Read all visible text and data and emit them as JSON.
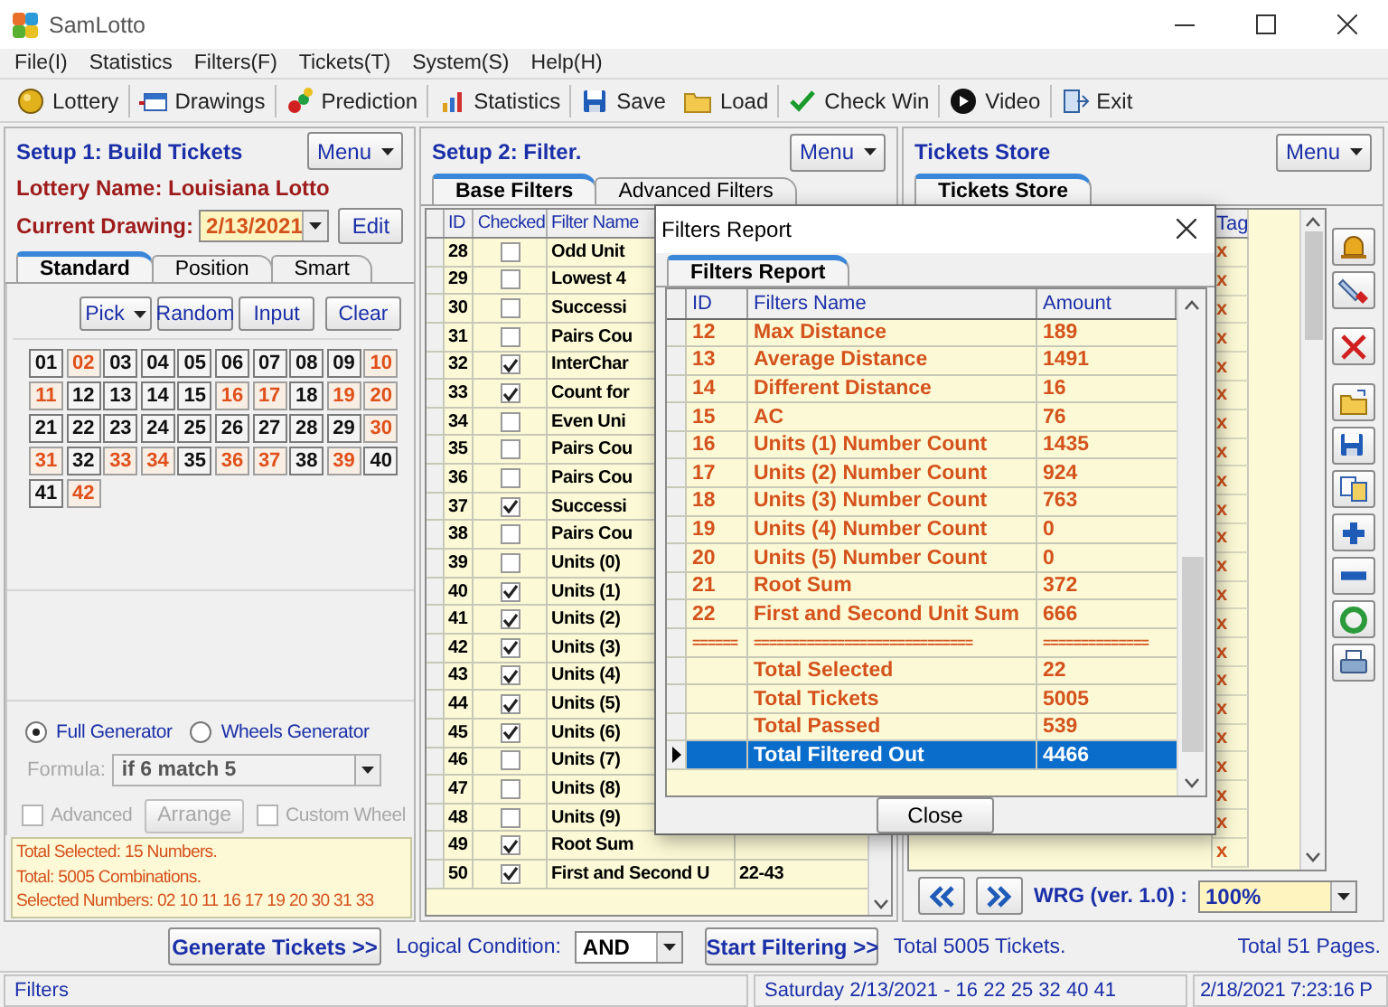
{
  "window": {
    "title": "SamLotto"
  },
  "menu": [
    "File(I)",
    "Statistics",
    "Filters(F)",
    "Tickets(T)",
    "System(S)",
    "Help(H)"
  ],
  "toolbar": [
    {
      "label": "Lottery",
      "kind": "lottery"
    },
    {
      "label": "Drawings",
      "kind": "drawings"
    },
    {
      "label": "Prediction",
      "kind": "prediction"
    },
    {
      "label": "Statistics",
      "kind": "statistics"
    },
    {
      "label": "Save",
      "kind": "save"
    },
    {
      "label": "Load",
      "kind": "load"
    },
    {
      "label": "Check Win",
      "kind": "checkwin"
    },
    {
      "label": "Video",
      "kind": "video"
    },
    {
      "label": "Exit",
      "kind": "exit"
    }
  ],
  "build": {
    "title": "Setup 1: Build  Tickets",
    "menu": "Menu",
    "lottery": "Lottery  Name: Louisiana Lotto",
    "drawing_label": "Current Drawing:",
    "drawing_value": "2/13/2021",
    "edit": "Edit",
    "tabs": [
      {
        "label": "Standard",
        "selected": true
      },
      {
        "label": "Position",
        "selected": false
      },
      {
        "label": "Smart",
        "selected": false
      }
    ],
    "pick": "Pick",
    "buttons": [
      "Random",
      "Input",
      "Clear"
    ],
    "numbers": [
      {
        "label": "01",
        "selected": false
      },
      {
        "label": "02",
        "selected": true
      },
      {
        "label": "03",
        "selected": false
      },
      {
        "label": "04",
        "selected": false
      },
      {
        "label": "05",
        "selected": false
      },
      {
        "label": "06",
        "selected": false
      },
      {
        "label": "07",
        "selected": false
      },
      {
        "label": "08",
        "selected": false
      },
      {
        "label": "09",
        "selected": false
      },
      {
        "label": "10",
        "selected": true
      },
      {
        "label": "11",
        "selected": true
      },
      {
        "label": "12",
        "selected": false
      },
      {
        "label": "13",
        "selected": false
      },
      {
        "label": "14",
        "selected": false
      },
      {
        "label": "15",
        "selected": false
      },
      {
        "label": "16",
        "selected": true
      },
      {
        "label": "17",
        "selected": true
      },
      {
        "label": "18",
        "selected": false
      },
      {
        "label": "19",
        "selected": true
      },
      {
        "label": "20",
        "selected": true
      },
      {
        "label": "21",
        "selected": false
      },
      {
        "label": "22",
        "selected": false
      },
      {
        "label": "23",
        "selected": false
      },
      {
        "label": "24",
        "selected": false
      },
      {
        "label": "25",
        "selected": false
      },
      {
        "label": "26",
        "selected": false
      },
      {
        "label": "27",
        "selected": false
      },
      {
        "label": "28",
        "selected": false
      },
      {
        "label": "29",
        "selected": false
      },
      {
        "label": "30",
        "selected": true
      },
      {
        "label": "31",
        "selected": true
      },
      {
        "label": "32",
        "selected": false
      },
      {
        "label": "33",
        "selected": true
      },
      {
        "label": "34",
        "selected": true
      },
      {
        "label": "35",
        "selected": false
      },
      {
        "label": "36",
        "selected": true
      },
      {
        "label": "37",
        "selected": true
      },
      {
        "label": "38",
        "selected": false
      },
      {
        "label": "39",
        "selected": true
      },
      {
        "label": "40",
        "selected": false
      },
      {
        "label": "41",
        "selected": false
      },
      {
        "label": "42",
        "selected": true
      }
    ],
    "generator": [
      {
        "label": "Full Generator",
        "selected": true
      },
      {
        "label": "Wheels Generator",
        "selected": false
      }
    ],
    "formula": {
      "label": "Formula:",
      "value": "if 6 match 5",
      "disabled": true
    },
    "options": [
      {
        "kind": "checkbox",
        "label": "Advanced",
        "checked": false,
        "disabled": true
      },
      {
        "kind": "button",
        "label": "Arrange",
        "disabled": true
      },
      {
        "kind": "checkbox",
        "label": "Custom Wheel",
        "checked": false,
        "disabled": true
      }
    ],
    "info": [
      "Total Selected: 15 Numbers.",
      "Total: 5005 Combinations.",
      "Selected Numbers: 02 10 11 16 17 19 20 30 31 33"
    ]
  },
  "filter": {
    "title": "Setup 2: Filter.",
    "menu": "Menu",
    "tabs": [
      {
        "label": "Base Filters",
        "selected": true
      },
      {
        "label": "Advanced Filters",
        "selected": false
      }
    ],
    "columns": [
      "ID",
      "Checked",
      "Filter Name"
    ],
    "rows": [
      {
        "id": "28",
        "checked": false,
        "name": "Odd Unit"
      },
      {
        "id": "29",
        "checked": false,
        "name": "Lowest 4"
      },
      {
        "id": "30",
        "checked": false,
        "name": "Successi"
      },
      {
        "id": "31",
        "checked": false,
        "name": "Pairs Cou"
      },
      {
        "id": "32",
        "checked": true,
        "name": "InterChar"
      },
      {
        "id": "33",
        "checked": true,
        "name": "Count for"
      },
      {
        "id": "34",
        "checked": false,
        "name": "Even Uni"
      },
      {
        "id": "35",
        "checked": false,
        "name": "Pairs Cou"
      },
      {
        "id": "36",
        "checked": false,
        "name": "Pairs Cou"
      },
      {
        "id": "37",
        "checked": true,
        "name": "Successi"
      },
      {
        "id": "38",
        "checked": false,
        "name": "Pairs Cou"
      },
      {
        "id": "39",
        "checked": false,
        "name": "Units (0)"
      },
      {
        "id": "40",
        "checked": true,
        "name": "Units (1)"
      },
      {
        "id": "41",
        "checked": true,
        "name": "Units (2)"
      },
      {
        "id": "42",
        "checked": true,
        "name": "Units (3)"
      },
      {
        "id": "43",
        "checked": true,
        "name": "Units (4)"
      },
      {
        "id": "44",
        "checked": true,
        "name": "Units (5)"
      },
      {
        "id": "45",
        "checked": true,
        "name": "Units (6)"
      },
      {
        "id": "46",
        "checked": false,
        "name": "Units (7)"
      },
      {
        "id": "47",
        "checked": false,
        "name": "Units (8)"
      },
      {
        "id": "48",
        "checked": false,
        "name": "Units (9)"
      },
      {
        "id": "49",
        "checked": true,
        "name": "Root Sum"
      },
      {
        "id": "50",
        "checked": true,
        "name": "First and Second U",
        "column_4": "22-43"
      }
    ]
  },
  "store": {
    "title": "Tickets Store",
    "menu": "Menu",
    "tabs": [
      {
        "label": "Tickets Store",
        "selected": true
      }
    ],
    "columns": [
      "Tag"
    ],
    "rows": [
      {
        "tag": "x"
      },
      {
        "tag": "x"
      },
      {
        "tag": "x"
      },
      {
        "tag": "x"
      },
      {
        "tag": "x"
      },
      {
        "tag": "x"
      },
      {
        "tag": "x"
      },
      {
        "tag": "x"
      },
      {
        "tag": "x"
      },
      {
        "tag": "x"
      },
      {
        "tag": "x"
      },
      {
        "tag": "x"
      },
      {
        "tag": "x"
      },
      {
        "tag": "x"
      },
      {
        "tag": "x"
      },
      {
        "tag": "x"
      },
      {
        "tag": "x"
      },
      {
        "tag": "x"
      },
      {
        "tag": "x"
      },
      {
        "tag": "x"
      },
      {
        "tag": "x"
      },
      {
        "tag": "x"
      }
    ],
    "tools": [
      {
        "kind": "bell"
      },
      {
        "kind": "marker"
      },
      {
        "kind": "delete"
      },
      {
        "kind": "open"
      },
      {
        "kind": "save"
      },
      {
        "kind": "copy"
      },
      {
        "kind": "add"
      },
      {
        "kind": "remove"
      },
      {
        "kind": "recycle"
      },
      {
        "kind": "print"
      }
    ],
    "version": "WRG (ver. 1.0) :",
    "zoom": "100%"
  },
  "actions": {
    "generate": "Generate Tickets >>",
    "logic_label": "Logical Condition:",
    "logic_value": "AND",
    "start": "Start Filtering >>",
    "total_tickets": "Total 5005 Tickets.",
    "total_pages": "Total 51 Pages."
  },
  "status_bar": [
    "Filters",
    "Saturday 2/13/2021 - 16 22 25 32 40 41",
    "2/18/2021 7:23:16 P"
  ],
  "dialog": {
    "title": "Filters Report",
    "tab": "Filters Report",
    "columns": [
      "ID",
      "Filters Name",
      "Amount"
    ],
    "rows": [
      {
        "id": "12",
        "name": "Max Distance",
        "amount": "189",
        "selected": false
      },
      {
        "id": "13",
        "name": "Average Distance",
        "amount": "1491",
        "selected": false
      },
      {
        "id": "14",
        "name": "Different Distance",
        "amount": "16",
        "selected": false
      },
      {
        "id": "15",
        "name": "AC",
        "amount": "76",
        "selected": false
      },
      {
        "id": "16",
        "name": "Units (1) Number Count",
        "amount": "1435",
        "selected": false
      },
      {
        "id": "17",
        "name": "Units (2) Number Count",
        "amount": "924",
        "selected": false
      },
      {
        "id": "18",
        "name": "Units (3) Number Count",
        "amount": "763",
        "selected": false
      },
      {
        "id": "19",
        "name": "Units (4) Number Count",
        "amount": "0",
        "selected": false
      },
      {
        "id": "20",
        "name": "Units (5) Number Count",
        "amount": "0",
        "selected": false
      },
      {
        "id": "21",
        "name": "Root Sum",
        "amount": "372",
        "selected": false
      },
      {
        "id": "22",
        "name": "First and Second Unit Sum",
        "amount": "666",
        "selected": false
      },
      {
        "id": "======",
        "name": "=============================",
        "amount": "==============",
        "selected": false
      },
      {
        "name": "Total Selected",
        "amount": "22",
        "selected": false
      },
      {
        "name": "Total Tickets",
        "amount": "5005",
        "selected": false
      },
      {
        "name": "Total Passed",
        "amount": "539",
        "selected": false
      },
      {
        "name": "Total Filtered Out",
        "amount": "4466",
        "selected": true
      }
    ],
    "close": "Close"
  }
}
